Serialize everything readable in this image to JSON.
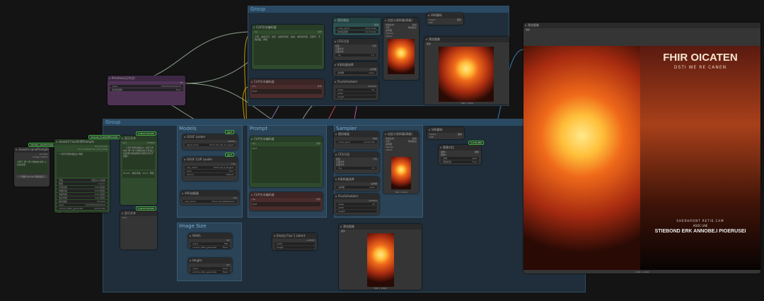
{
  "groups": {
    "top": "Group",
    "main": "Group",
    "models": "Models",
    "prompt": "Prompt",
    "sampler": "Sampler",
    "image_size": "Image Size"
  },
  "nodes": [
    {
      "id": "nano",
      "title": "ckooshi nanoPrompts",
      "color": "",
      "io": [
        [
          "",
          "prompt"
        ],
        [
          "",
          "image_output"
        ]
      ],
      "text": "夕阳下,两个男人弹吉他,剪影,火红的太阳",
      "button": "⚡ 刷新 ckooshi 服务提示"
    },
    {
      "id": "flux",
      "title": "ckooshi FluxShiftPrompts",
      "color": "green",
      "io": [
        [
          "",
          "flux_prompt"
        ],
        [
          "",
          "full_contents_for_2nd_comp"
        ]
      ],
      "text": "一个音乐专辑封面设计海报",
      "widgets": [
        [
          "风格",
          "内置(LLM)选择"
        ],
        [
          "模型",
          "cococo"
        ],
        [
          "光线风格",
          "Auto(自动)"
        ],
        [
          "构图风格",
          "Auto(自动)"
        ],
        [
          "情绪风格",
          "Auto(自动)"
        ],
        [
          "色彩风格",
          "Auto(自动)"
        ],
        [
          "输出语言",
          "Chinese"
        ],
        [
          "seed",
          "759435621654215"
        ],
        [
          "control_after_generate",
          "randomize"
        ]
      ],
      "text2": "音乐、文字排版设计等"
    },
    {
      "id": "show1",
      "title": "显示文本",
      "color": "green",
      "io": [
        [
          "text",
          "STRING"
        ]
      ],
      "text": "一个音乐专辑封面设计,夕阳下的剪影,两个男人弹着吉他,背景是火红的落日和枯树枝,标题文字位于顶部...",
      "text2": "Studio、电影风格、Vivid、明亮"
    },
    {
      "id": "show2",
      "title": "显示文本",
      "color": "",
      "io": [
        [
          "text",
          ""
        ]
      ]
    },
    {
      "id": "prim",
      "title": "Primitive(元节点)",
      "color": "purple",
      "io": [
        [
          "",
          "INT"
        ]
      ],
      "widgets": [
        [
          "value",
          "759435621654215"
        ],
        [
          "生成后控制",
          "fixed"
        ]
      ]
    },
    {
      "id": "t_clip_pos",
      "title": "CLIP文本编码器",
      "color": "green",
      "io": [
        [
          "clip",
          "条件"
        ]
      ],
      "text": "夕阳、金色天空、剪影、吉他手剪影、枯树、电影级光照、高细节、专辑封面、排版"
    },
    {
      "id": "t_clip_neg",
      "title": "CLIP文本编码器",
      "color": "red",
      "io": [
        [
          "clip",
          "条件"
        ]
      ],
      "text": "text"
    },
    {
      "id": "t_noise",
      "title": "随机噪波",
      "color": "teal",
      "io": [
        [
          "",
          "噪波"
        ]
      ],
      "widgets": [
        [
          "noise_seed",
          "randomize"
        ],
        [
          "生成后控制",
          "randomize"
        ]
      ]
    },
    {
      "id": "t_cfg",
      "title": "CFG引导",
      "color": "",
      "io": [
        [
          "模型",
          "引导"
        ],
        [
          "正面条件",
          ""
        ],
        [
          "负面条件",
          ""
        ]
      ],
      "widgets": [
        [
          "cfg",
          "1.0"
        ]
      ]
    },
    {
      "id": "t_ksel",
      "title": "K采样器选择",
      "color": "",
      "io": [
        [
          "",
          "采样器"
        ]
      ],
      "widgets": [
        [
          "采样器",
          "euler"
        ]
      ]
    },
    {
      "id": "t_sched",
      "title": "FluxScheduler",
      "color": "",
      "io": [
        [
          "",
          "SIGMAS"
        ]
      ],
      "widgets": [
        [
          "steps",
          "20"
        ],
        [
          "width",
          ""
        ],
        [
          "height",
          ""
        ]
      ]
    },
    {
      "id": "t_adv",
      "title": "自定义采样器(高级)",
      "color": "",
      "io": [
        [
          "噪波生成",
          "输出"
        ],
        [
          "引导",
          "降噪输出"
        ],
        [
          "采样器",
          ""
        ],
        [
          "Sigmas",
          ""
        ],
        [
          "Latent",
          ""
        ]
      ]
    },
    {
      "id": "t_vae",
      "title": "VAE解码",
      "color": "",
      "io": [
        [
          "Latent",
          "图像"
        ],
        [
          "VAE",
          ""
        ]
      ]
    },
    {
      "id": "t_prev",
      "title": "预览图像",
      "color": "",
      "io": [
        [
          "图像",
          ""
        ]
      ],
      "caption": "768 × 1024"
    },
    {
      "id": "gguf",
      "title": "GGUF Loader",
      "color": "",
      "badge": "gguf",
      "io": [
        [
          "",
          "MODEL"
        ]
      ],
      "widgets": [
        [
          "gguf_name",
          "flux1-dev-Q4_K_S.gguf"
        ]
      ]
    },
    {
      "id": "gclip",
      "title": "GGUF CLIP Loader",
      "color": "",
      "badge": "gguf",
      "io": [
        [
          "",
          "CLIP"
        ]
      ],
      "widgets": [
        [
          "clip_name",
          "t5xxl-Q4_K_M.gguf"
        ],
        [
          "type",
          "flux"
        ],
        [
          "device",
          "default"
        ]
      ]
    },
    {
      "id": "vael",
      "title": "VAE加载器",
      "color": "",
      "io": [
        [
          "",
          "VAE"
        ]
      ],
      "widgets": [
        [
          "vae_name",
          "flux1-vae.safetensors"
        ]
      ]
    },
    {
      "id": "b_clip_pos",
      "title": "CLIP文本编码器",
      "color": "green",
      "io": [
        [
          "clip",
          "条件"
        ]
      ],
      "text": "text"
    },
    {
      "id": "b_clip_neg",
      "title": "CLIP文本编码器",
      "color": "red",
      "io": [
        [
          "clip",
          "条件"
        ]
      ],
      "text": "text"
    },
    {
      "id": "b_noise",
      "title": "随机噪波",
      "color": "",
      "io": [
        [
          "",
          "噪波"
        ]
      ],
      "widgets": [
        [
          "noise_seed",
          "randomize"
        ]
      ]
    },
    {
      "id": "b_cfg",
      "title": "CFG引导",
      "color": "",
      "io": [
        [
          "模型",
          "引导"
        ],
        [
          "正面条件",
          ""
        ],
        [
          "负面条件",
          ""
        ]
      ],
      "widgets": [
        [
          "cfg",
          "3.5"
        ]
      ]
    },
    {
      "id": "b_ksel",
      "title": "K采样器选择",
      "color": "",
      "io": [
        [
          "",
          "采样器"
        ]
      ],
      "widgets": [
        [
          "采样器",
          "euler"
        ]
      ]
    },
    {
      "id": "b_sched",
      "title": "FluxScheduler",
      "color": "",
      "io": [
        [
          "",
          "SIGMAS"
        ]
      ],
      "widgets": [
        [
          "steps",
          "20"
        ],
        [
          "width",
          ""
        ],
        [
          "height",
          ""
        ]
      ]
    },
    {
      "id": "b_adv",
      "title": "自定义采样器(高级)",
      "color": "",
      "io": [
        [
          "噪波生成",
          "输出"
        ],
        [
          "引导",
          "降噪输出"
        ],
        [
          "采样器",
          ""
        ],
        [
          "Sigmas",
          ""
        ],
        [
          "Latent",
          ""
        ]
      ],
      "caption": "768 × 1024"
    },
    {
      "id": "b_vae",
      "title": "VAE解码",
      "color": "",
      "io": [
        [
          "Latent",
          "图像"
        ],
        [
          "VAE",
          ""
        ]
      ]
    },
    {
      "id": "cmp",
      "title": "图像对比",
      "color": "",
      "badge": "Comfy-Mtb",
      "io": [
        [
          "图像1",
          "图像"
        ],
        [
          "图像2",
          ""
        ]
      ],
      "widgets": [
        [
          "方向",
          "right"
        ],
        [
          "添加标签",
          "true"
        ]
      ]
    },
    {
      "id": "width",
      "title": "Width",
      "color": "",
      "io": [
        [
          "",
          "INT"
        ]
      ],
      "widgets": [
        [
          "value",
          "768"
        ],
        [
          "control_after_generate",
          "fixed"
        ]
      ]
    },
    {
      "id": "height",
      "title": "Height",
      "color": "",
      "io": [
        [
          "",
          "INT"
        ]
      ],
      "widgets": [
        [
          "value",
          "1024"
        ],
        [
          "control_after_generate",
          "fixed"
        ]
      ]
    },
    {
      "id": "latent",
      "title": "Empty Flux 1 Latent",
      "color": "",
      "io": [
        [
          "",
          "LATENT"
        ]
      ],
      "widgets": [
        [
          "width",
          ""
        ],
        [
          "height",
          ""
        ],
        [
          "batch_size",
          "1"
        ]
      ]
    },
    {
      "id": "b_prev",
      "title": "预览图像",
      "color": "",
      "io": [
        [
          "图像",
          ""
        ]
      ],
      "caption": "768 × 1024"
    },
    {
      "id": "big_prev",
      "title": "预览图像",
      "color": "",
      "io": [
        [
          "图像",
          ""
        ]
      ],
      "caption": "1536 × 1024"
    }
  ],
  "badges": {
    "flux": "Ckooshi_FluxShiftPrompts",
    "nano": "ckooshi_nanoPrompts",
    "show1": "Custom-Scripts",
    "show2": "Custom-Scripts"
  },
  "poster": {
    "title": "FHIR OICATEN",
    "subtitle": "DSTI WE RE CANEN",
    "line1": "SHERHRONT RETIE.CAM",
    "line2": "ASOC UAE",
    "line3": "STIEBOND ERK ANNOBE.I PIOERUSEI"
  },
  "colors": {
    "canvas": "#141414",
    "group": "#1f2e3a",
    "wire_clip": "#e0b000",
    "wire_model": "#a080d0",
    "wire_latent": "#d060c0",
    "wire_image": "#4090d0",
    "wire_int": "#a0b8a0",
    "wire_vae": "#e05060"
  }
}
